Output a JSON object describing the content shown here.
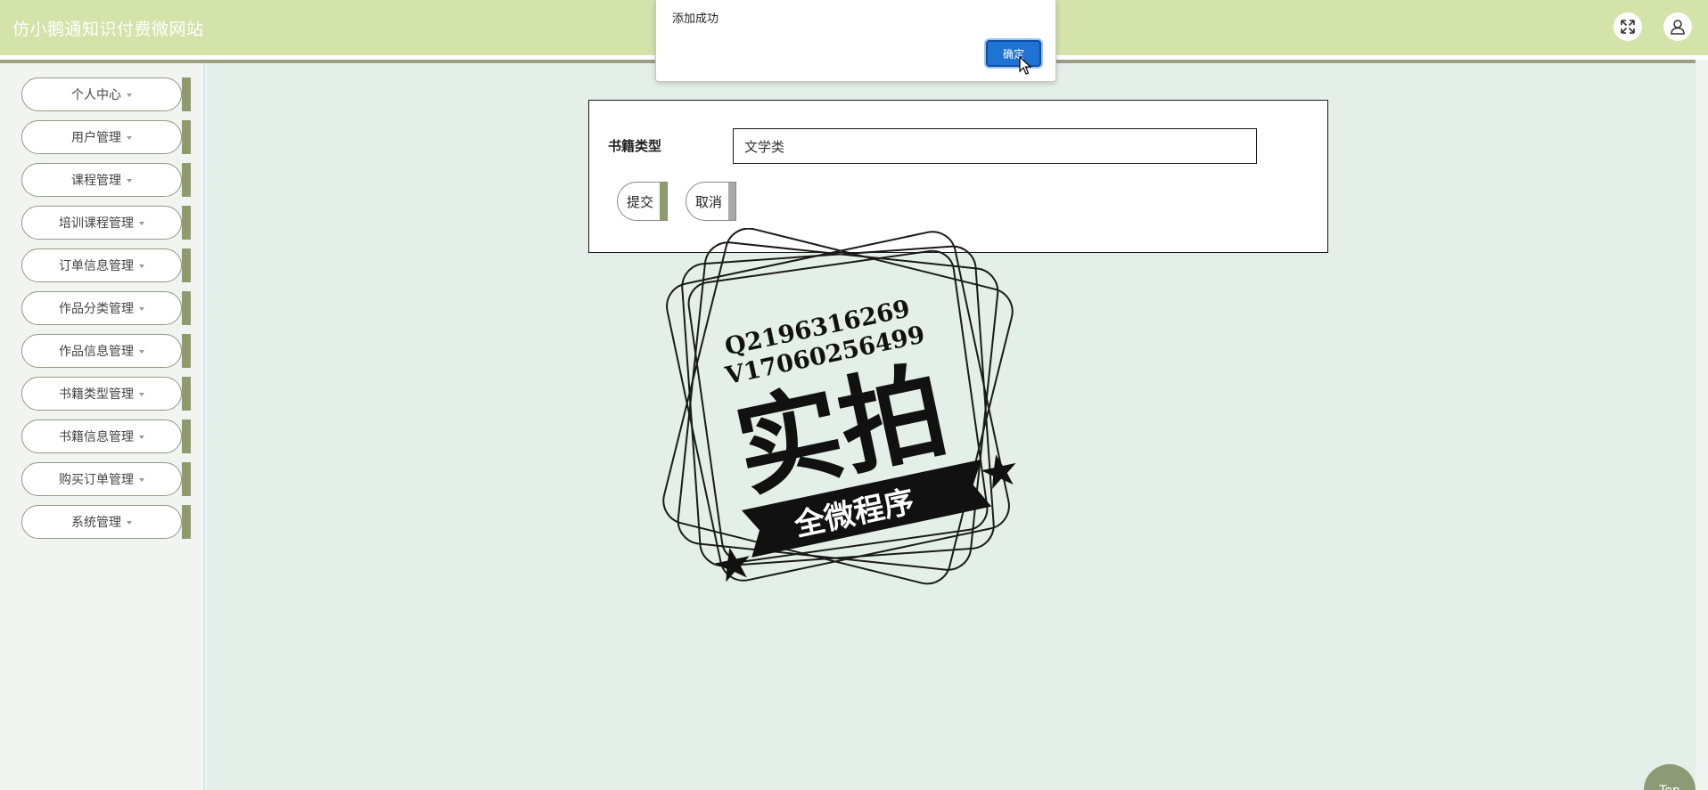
{
  "app": {
    "title": "仿小鹅通知识付费微网站"
  },
  "header": {
    "fullscreen_icon": "fullscreen-icon",
    "user_icon": "user-icon"
  },
  "sidebar": {
    "items": [
      {
        "label": "个人中心"
      },
      {
        "label": "用户管理"
      },
      {
        "label": "课程管理"
      },
      {
        "label": "培训课程管理"
      },
      {
        "label": "订单信息管理"
      },
      {
        "label": "作品分类管理"
      },
      {
        "label": "作品信息管理"
      },
      {
        "label": "书籍类型管理"
      },
      {
        "label": "书籍信息管理"
      },
      {
        "label": "购买订单管理"
      },
      {
        "label": "系统管理"
      }
    ]
  },
  "form": {
    "field_label": "书籍类型",
    "field_value": "文学类",
    "submit_label": "提交",
    "cancel_label": "取消"
  },
  "dialog": {
    "message": "添加成功",
    "ok_label": "确定"
  },
  "watermark": {
    "line1": "Q2196316269",
    "line2": "V17060256499",
    "big_text": "实拍",
    "banner_text": "全微程序"
  },
  "back_to_top": {
    "label": "Top"
  },
  "colors": {
    "header_bg": "#d3e3a9",
    "accent_bar": "#909a6c",
    "content_bg": "#e5efe9",
    "dialog_ok": "#1f73d4"
  }
}
